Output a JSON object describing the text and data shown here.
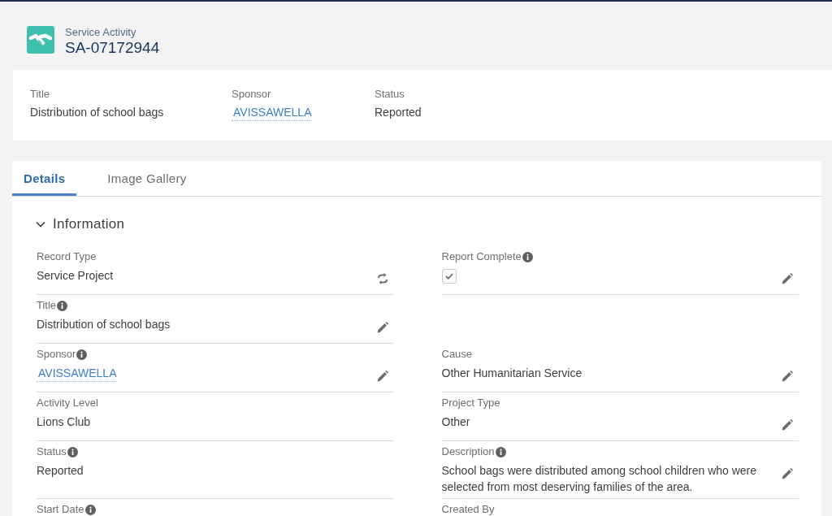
{
  "record": {
    "object_type": "Service Activity",
    "name": "SA-07172944"
  },
  "highlights": [
    {
      "label": "Title",
      "value": "Distribution of school bags",
      "kind": "text"
    },
    {
      "label": "Sponsor",
      "value": "AVISSAWELLA",
      "kind": "link"
    },
    {
      "label": "Status",
      "value": "Reported",
      "kind": "text"
    }
  ],
  "tabs": [
    {
      "label": "Details",
      "selected": true
    },
    {
      "label": "Image Gallery",
      "selected": false
    }
  ],
  "section": {
    "title": "Information",
    "expanded": true,
    "rows": [
      {
        "left": {
          "label": "Record Type",
          "info": false,
          "kind": "text",
          "value": "Service Project",
          "editable": false,
          "changeable": true
        },
        "right": {
          "label": "Report Complete",
          "info": true,
          "kind": "checkbox",
          "checked": true,
          "editable": true,
          "changeable": false
        }
      },
      {
        "left": {
          "label": "Title",
          "info": true,
          "kind": "text",
          "value": "Distribution of school bags",
          "editable": true,
          "changeable": false
        }
      },
      {
        "left": {
          "label": "Sponsor",
          "info": true,
          "kind": "link",
          "value": "AVISSAWELLA",
          "editable": true,
          "changeable": false
        },
        "right": {
          "label": "Cause",
          "info": false,
          "kind": "text",
          "value": "Other Humanitarian Service",
          "editable": true,
          "changeable": false
        }
      },
      {
        "left": {
          "label": "Activity Level",
          "info": false,
          "kind": "text",
          "value": "Lions Club",
          "editable": false,
          "changeable": false
        },
        "right": {
          "label": "Project Type",
          "info": false,
          "kind": "text",
          "value": "Other",
          "editable": true,
          "changeable": false
        }
      },
      {
        "left": {
          "label": "Status",
          "info": true,
          "kind": "text",
          "value": "Reported",
          "editable": false,
          "changeable": false
        },
        "right": {
          "label": "Description",
          "info": true,
          "kind": "text",
          "value": "School bags were distributed among school children who were selected from most deserving families of the area.",
          "editable": true,
          "changeable": false
        }
      },
      {
        "left": {
          "label": "Start Date",
          "info": true
        },
        "right": {
          "label": "Created By",
          "info": false
        }
      }
    ]
  }
}
